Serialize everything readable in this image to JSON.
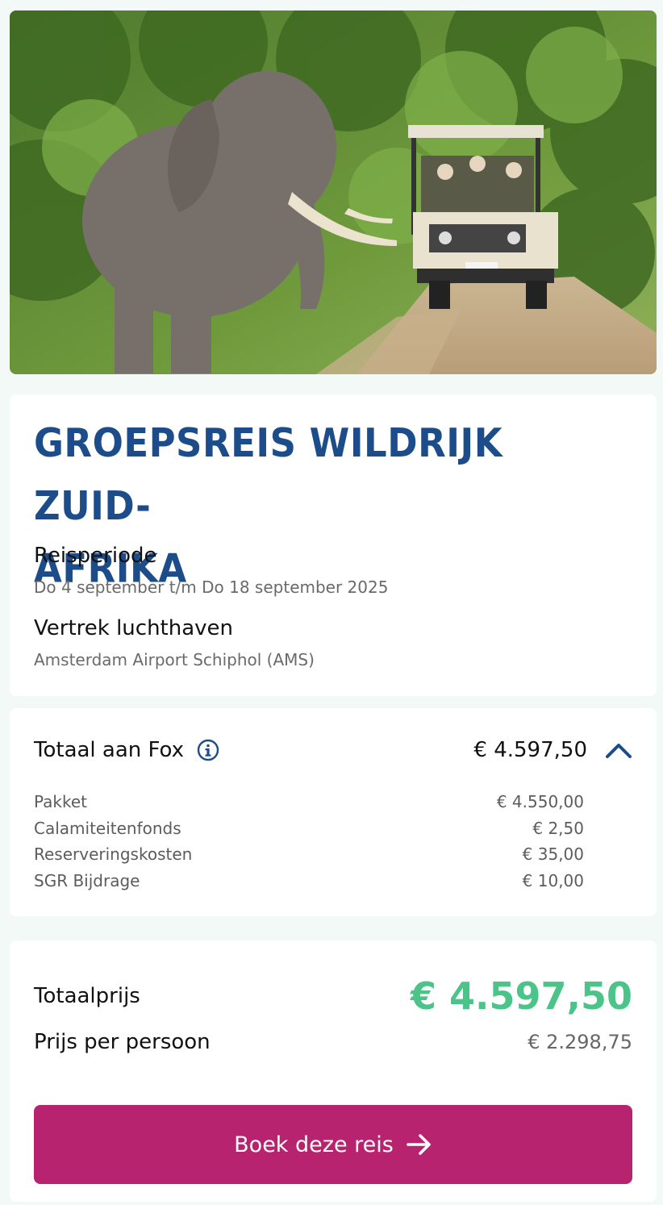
{
  "hero": {
    "alt_icon": "safari-photo-elephant-jeep"
  },
  "trip": {
    "title_line1": "GROEPSREIS WILDRIJK ZUID-",
    "title_line2": "AFRIKA",
    "period_label": "Reisperiode",
    "period_value": "Do 4 september t/m Do 18 september 2025",
    "airport_label": "Vertrek luchthaven",
    "airport_value": "Amsterdam Airport Schiphol (AMS)"
  },
  "fox": {
    "title": "Totaal aan Fox",
    "info_icon": "info-icon",
    "total": "€ 4.597,50",
    "toggle_icon": "chevron-up-icon",
    "lines": [
      {
        "label": "Pakket",
        "value": "€ 4.550,00"
      },
      {
        "label": "Calamiteitenfonds",
        "value": "€ 2,50"
      },
      {
        "label": "Reserveringskosten",
        "value": "€ 35,00"
      },
      {
        "label": "SGR Bijdrage",
        "value": "€ 10,00"
      }
    ]
  },
  "summary": {
    "total_label": "Totaalprijs",
    "total_value": "€ 4.597,50",
    "pp_label": "Prijs per persoon",
    "pp_value": "€ 2.298,75",
    "book_label": "Boek deze reis",
    "book_icon": "arrow-right-icon"
  },
  "colors": {
    "brand_blue": "#1d4c8a",
    "price_green": "#4cc389",
    "cta_magenta": "#b8236f"
  }
}
